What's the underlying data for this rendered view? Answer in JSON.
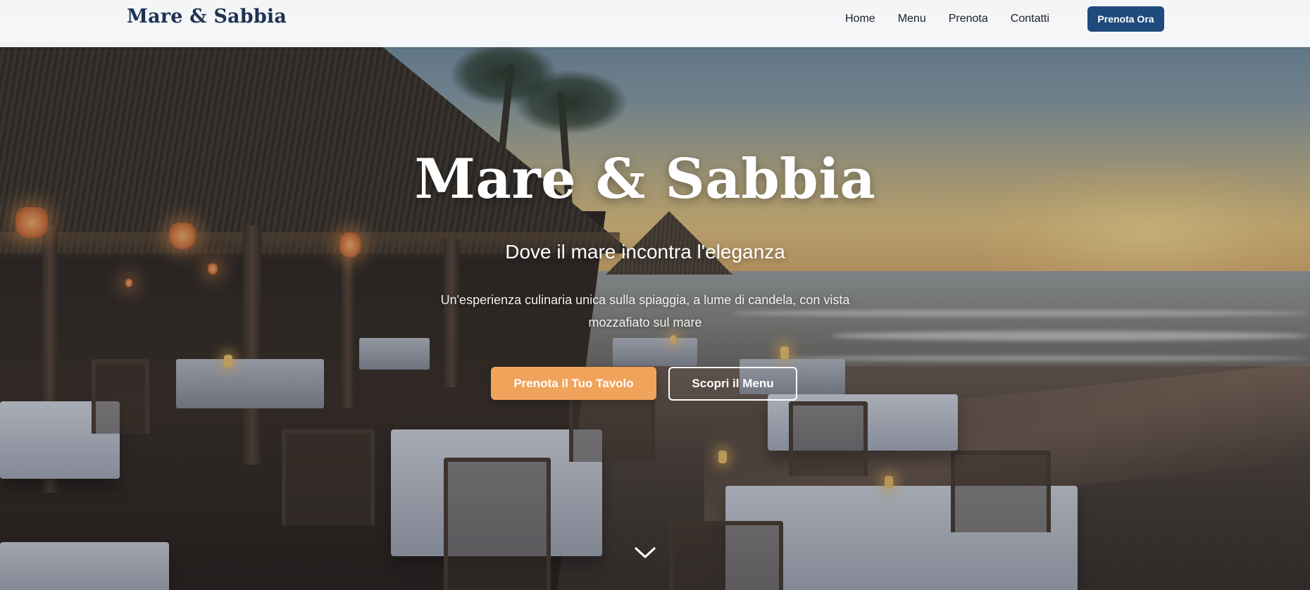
{
  "header": {
    "logo": "Mare & Sabbia",
    "nav": [
      {
        "label": "Home"
      },
      {
        "label": "Menu"
      },
      {
        "label": "Prenota"
      },
      {
        "label": "Contatti"
      }
    ],
    "cta_label": "Prenota Ora"
  },
  "hero": {
    "title": "Mare & Sabbia",
    "subtitle": "Dove il mare incontra l'eleganza",
    "description": "Un'esperienza culinaria unica sulla spiaggia, a lume di candela, con vista mozzafiato sul mare",
    "primary_button": "Prenota il Tuo Tavolo",
    "secondary_button": "Scopri il Menu",
    "scroll_icon": "chevron-down-icon"
  },
  "colors": {
    "brand_navy": "#1e3352",
    "cta_blue": "#1f4a7c",
    "accent_orange": "#f0a35a",
    "header_bg": "#f9fafb",
    "text_white": "#ffffff"
  }
}
